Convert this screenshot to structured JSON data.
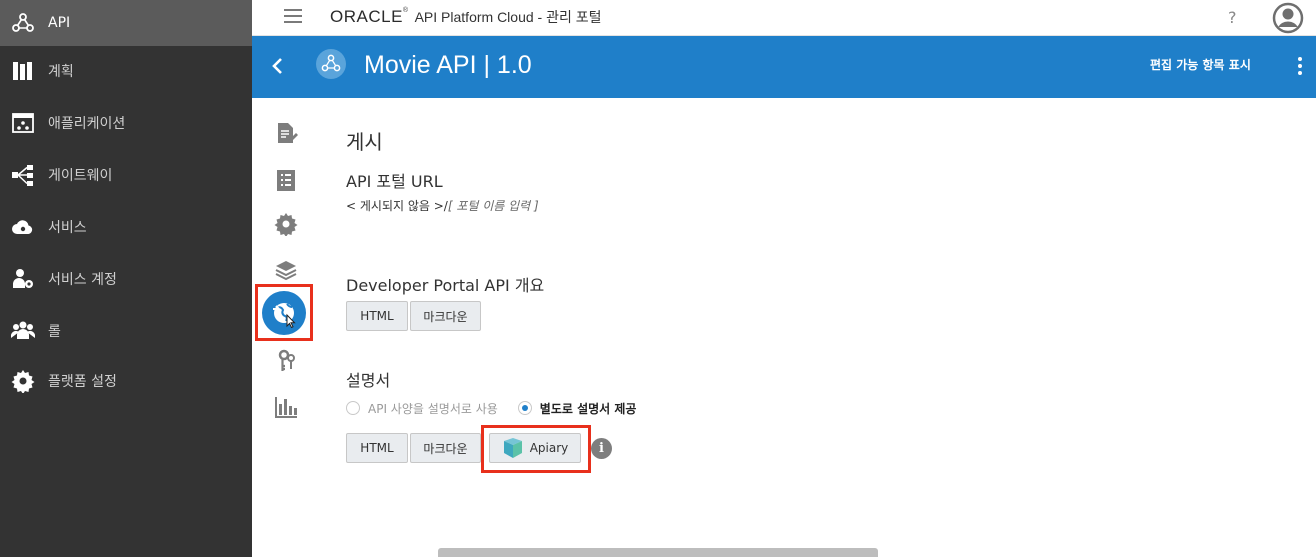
{
  "nav": {
    "items": [
      {
        "label": "API",
        "icon": "api-icon",
        "active": true
      },
      {
        "label": "계획",
        "icon": "plans-icon"
      },
      {
        "label": "애플리케이션",
        "icon": "applications-icon"
      },
      {
        "label": "게이트웨이",
        "icon": "gateways-icon"
      },
      {
        "label": "서비스",
        "icon": "services-icon"
      },
      {
        "label": "서비스 계정",
        "icon": "service-accounts-icon"
      },
      {
        "label": "롤",
        "icon": "roles-icon"
      },
      {
        "label": "플랫폼 설정",
        "icon": "platform-settings-icon"
      }
    ]
  },
  "topbar": {
    "logo": "ORACLE",
    "title": "API Platform Cloud - 관리 포털",
    "help": "?"
  },
  "header": {
    "api_title": "Movie API | 1.0",
    "edit_label": "편집 가능 항목 표시"
  },
  "main": {
    "page_title": "게시",
    "portal_url": {
      "heading": "API 포털 URL",
      "prefix": "< 게시되지 않음 >/",
      "placeholder": "[ 포털 이름 입력 ]"
    },
    "overview": {
      "heading": "Developer Portal API 개요",
      "html_button": "HTML",
      "markdown_button": "마크다운"
    },
    "docs": {
      "heading": "설명서",
      "radio_api_spec": "API 사양을 설명서로 사용",
      "radio_separate": "별도로 설명서 제공",
      "selected": "radio_separate",
      "html_button": "HTML",
      "markdown_button": "마크다운",
      "apiary_button": "Apiary",
      "info": "i"
    }
  },
  "colors": {
    "nav_bg": "#333333",
    "nav_active": "#5b5b5b",
    "header_blue": "#1f7fc9",
    "highlight_red": "#e8301c"
  }
}
